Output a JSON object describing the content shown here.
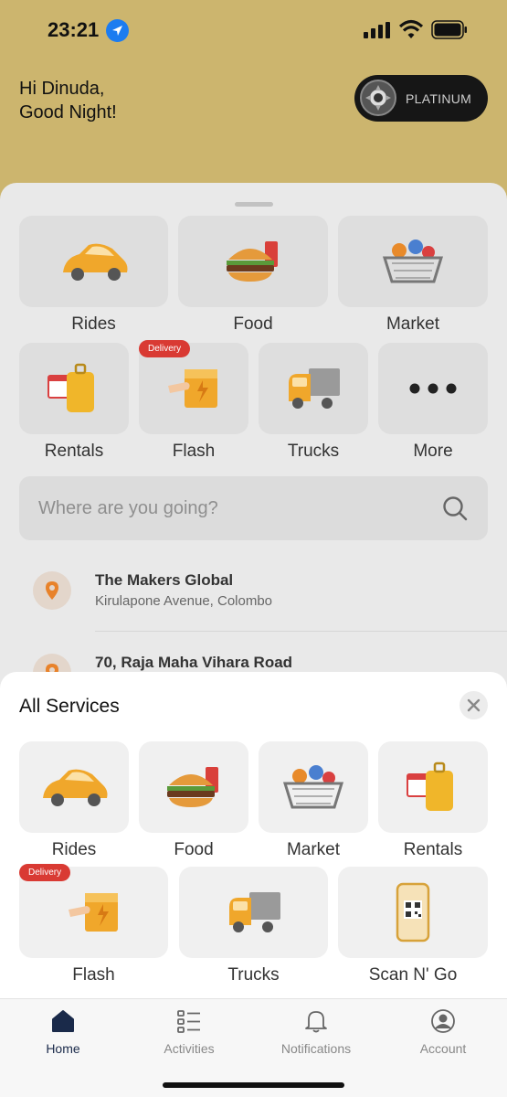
{
  "status_bar": {
    "time": "23:21",
    "location_icon": "location-arrow-icon",
    "signal_icon": "cellular-signal-icon",
    "wifi_icon": "wifi-icon",
    "battery_icon": "battery-icon"
  },
  "header": {
    "greeting_line1": "Hi Dinuda,",
    "greeting_line2": "Good Night!",
    "tier_label": "PLATINUM",
    "background_color": "#ccb56e"
  },
  "main": {
    "services_row1": [
      {
        "label": "Rides",
        "icon": "car-icon"
      },
      {
        "label": "Food",
        "icon": "burger-icon"
      },
      {
        "label": "Market",
        "icon": "basket-icon"
      }
    ],
    "services_row2": [
      {
        "label": "Rentals",
        "icon": "suitcase-icon"
      },
      {
        "label": "Flash",
        "icon": "package-icon",
        "badge": "Delivery"
      },
      {
        "label": "Trucks",
        "icon": "truck-icon"
      },
      {
        "label": "More",
        "icon": "more-dots-icon"
      }
    ],
    "search": {
      "placeholder": "Where are you going?"
    },
    "recent_places": [
      {
        "name": "The Makers Global",
        "address": "Kirulapone Avenue, Colombo"
      },
      {
        "name": "70, Raja Maha Vihara Road",
        "address": ""
      }
    ]
  },
  "all_services": {
    "title": "All Services",
    "row1": [
      {
        "label": "Rides",
        "icon": "car-icon"
      },
      {
        "label": "Food",
        "icon": "burger-icon"
      },
      {
        "label": "Market",
        "icon": "basket-icon"
      },
      {
        "label": "Rentals",
        "icon": "suitcase-icon"
      }
    ],
    "row2": [
      {
        "label": "Flash",
        "icon": "package-icon",
        "badge": "Delivery"
      },
      {
        "label": "Trucks",
        "icon": "truck-icon"
      },
      {
        "label": "Scan N' Go",
        "icon": "qr-phone-icon"
      }
    ]
  },
  "tabbar": {
    "tabs": [
      {
        "label": "Home",
        "icon": "home-icon",
        "active": true
      },
      {
        "label": "Activities",
        "icon": "list-icon",
        "active": false
      },
      {
        "label": "Notifications",
        "icon": "bell-icon",
        "active": false
      },
      {
        "label": "Account",
        "icon": "account-icon",
        "active": false
      }
    ]
  },
  "colors": {
    "accent": "#d93a33",
    "active_tab": "#1a2a4a",
    "pin": "#e8822a"
  }
}
